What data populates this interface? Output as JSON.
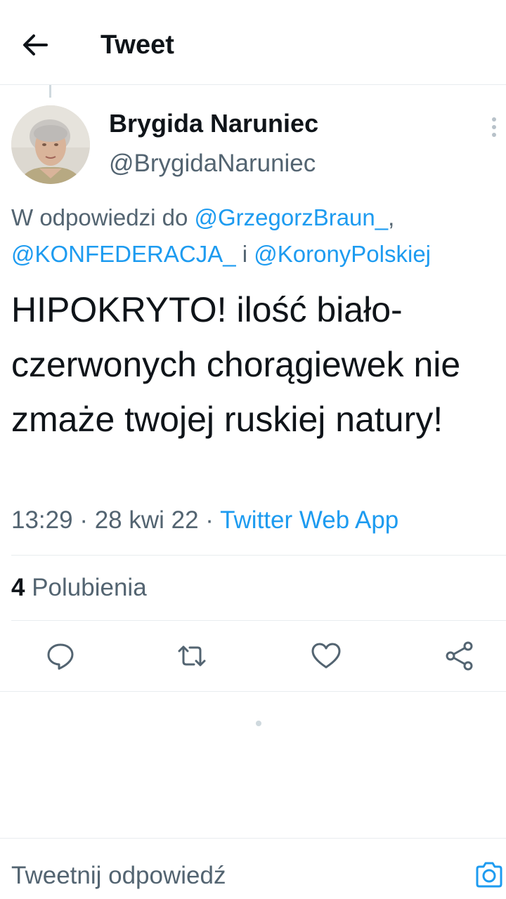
{
  "header": {
    "title": "Tweet"
  },
  "author": {
    "name": "Brygida Naruniec",
    "handle": "@BrygidaNaruniec"
  },
  "reply_context": {
    "prefix": "W odpowiedzi do ",
    "mention1": "@GrzegorzBraun_",
    "sep1": ",",
    "mention2": "@KONFEDERACJA_",
    "sep2": " i ",
    "mention3": "@KoronyPolskiej"
  },
  "tweet": {
    "text": "HIPOKRYTO! ilość biało-czerwonych chorągiewek nie zmaże twojej ruskiej natury!",
    "time": "13:29",
    "date": "28 kwi 22",
    "separator": " · ",
    "source": "Twitter Web App"
  },
  "stats": {
    "likes_count": "4",
    "likes_label": "Polubienia"
  },
  "actions": [
    "reply-icon",
    "retweet-icon",
    "like-icon",
    "share-icon"
  ],
  "reply_bar": {
    "placeholder": "Tweetnij odpowiedź"
  },
  "colors": {
    "accent": "#1d9bf0",
    "secondary_text": "#536471",
    "primary_text": "#0f1419",
    "divider": "#e8ecef"
  }
}
